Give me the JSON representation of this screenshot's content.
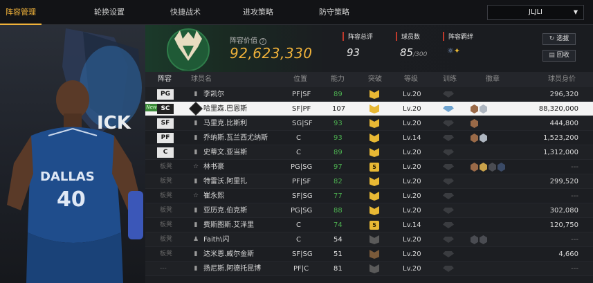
{
  "tabs": [
    {
      "label": "阵容管理",
      "active": true
    },
    {
      "label": "轮换设置",
      "active": false
    },
    {
      "label": "快捷战术",
      "active": false
    },
    {
      "label": "进攻策略",
      "active": false
    },
    {
      "label": "防守策略",
      "active": false
    }
  ],
  "team_select": {
    "value": "JLJLI"
  },
  "summary": {
    "value_label": "阵容价值",
    "value": "92,623,330",
    "rating_label": "阵容总评",
    "rating": "93",
    "players_label": "球员数",
    "players": "85",
    "players_max": "/300",
    "bonds_label": "阵容羁绊",
    "select_button": "选拔",
    "recall_button": "回收"
  },
  "columns": {
    "lineup": "阵容",
    "name": "球员名",
    "position": "位置",
    "ability": "能力",
    "breakthrough": "突破",
    "level": "等级",
    "training": "训练",
    "badges": "徽章",
    "salary": "球员身价"
  },
  "rows": [
    {
      "slot": "PG",
      "name": "李凯尔",
      "position": "PF|SF",
      "ability": "89",
      "level": "Lv.20",
      "salary": "296,320"
    },
    {
      "slot": "SC",
      "name": "哈里森.巴恩斯",
      "position": "SF|PF",
      "ability": "107",
      "level": "Lv.20",
      "salary": "88,320,000",
      "tag": "new"
    },
    {
      "slot": "SF",
      "name": "马里克.比斯利",
      "position": "SG|SF",
      "ability": "93",
      "level": "Lv.20",
      "salary": "444,800"
    },
    {
      "slot": "PF",
      "name": "乔纳斯.瓦兰西尤纳斯",
      "position": "C",
      "ability": "93",
      "level": "Lv.14",
      "salary": "1,523,200"
    },
    {
      "slot": "C",
      "name": "史蒂文.亚当斯",
      "position": "C",
      "ability": "89",
      "level": "Lv.20",
      "salary": "1,312,000"
    },
    {
      "slot": "板凳",
      "name": "林书豪",
      "position": "PG|SG",
      "ability": "97",
      "level": "Lv.20",
      "salary": "---"
    },
    {
      "slot": "板凳",
      "name": "特雷沃.阿里扎",
      "position": "PF|SF",
      "ability": "82",
      "level": "Lv.20",
      "salary": "299,520"
    },
    {
      "slot": "板凳",
      "name": "崔永熙",
      "position": "SF|SG",
      "ability": "77",
      "level": "Lv.20",
      "salary": "---"
    },
    {
      "slot": "板凳",
      "name": "亚历克.伯克斯",
      "position": "PG|SG",
      "ability": "88",
      "level": "Lv.20",
      "salary": "302,080"
    },
    {
      "slot": "板凳",
      "name": "费斯图斯.艾泽里",
      "position": "C",
      "ability": "74",
      "level": "Lv.14",
      "salary": "120,750"
    },
    {
      "slot": "板凳",
      "name": "Faith\\闪",
      "position": "C",
      "ability": "54",
      "level": "Lv.20",
      "salary": "---"
    },
    {
      "slot": "板凳",
      "name": "达米恩.威尔金斯",
      "position": "SF|SG",
      "ability": "51",
      "level": "Lv.20",
      "salary": "4,660"
    },
    {
      "slot": "---",
      "name": "扬尼斯.阿德托昆博",
      "position": "PF|C",
      "ability": "81",
      "level": "Lv.20",
      "salary": "---"
    }
  ],
  "player_art": {
    "jersey_text": "DALLAS",
    "jersey_number": "40"
  },
  "colors": {
    "accent": "#f0b23a",
    "ovr_green": "#4caf50"
  }
}
